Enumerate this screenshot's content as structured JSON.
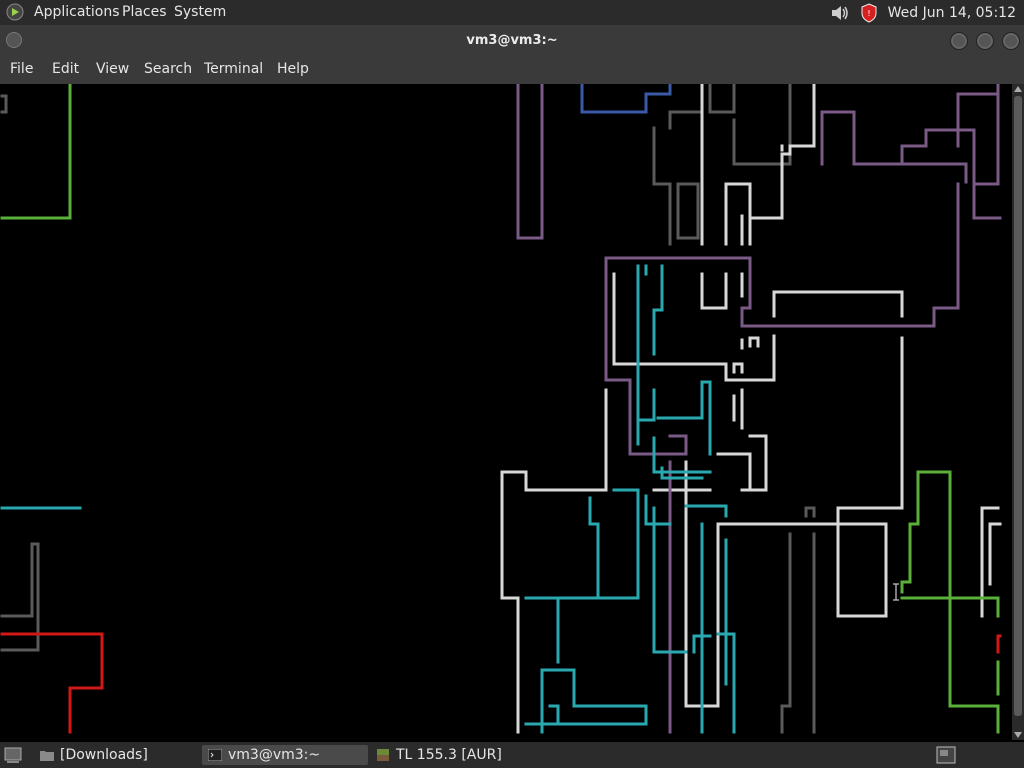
{
  "top_panel": {
    "menus": [
      "Applications",
      "Places",
      "System"
    ],
    "clock": "Wed Jun 14, 05:12",
    "volume_icon": "speaker-icon",
    "update_icon": "shield-icon"
  },
  "window": {
    "title": "vm3@vm3:~",
    "menu": [
      "File",
      "Edit",
      "View",
      "Search",
      "Terminal",
      "Help"
    ]
  },
  "taskbar": {
    "tasks": [
      {
        "label": "[Downloads]",
        "icon": "folder-icon"
      },
      {
        "label": "vm3@vm3:~",
        "icon": "terminal-icon"
      },
      {
        "label": "TL 155.3 [AUR]",
        "icon": "game-block-icon"
      }
    ]
  },
  "colors": {
    "panel_bg": "#2b2b2b",
    "window_bg": "#3a3a3a",
    "terminal_bg": "#000000",
    "pipe_white": "#d8d8d8",
    "pipe_teal": "#2aa8b0",
    "pipe_purple": "#7a5a86",
    "pipe_green": "#5ab03a",
    "pipe_red": "#d01818",
    "pipe_gray": "#5a5a5a",
    "pipe_blue": "#3a5aa8"
  }
}
